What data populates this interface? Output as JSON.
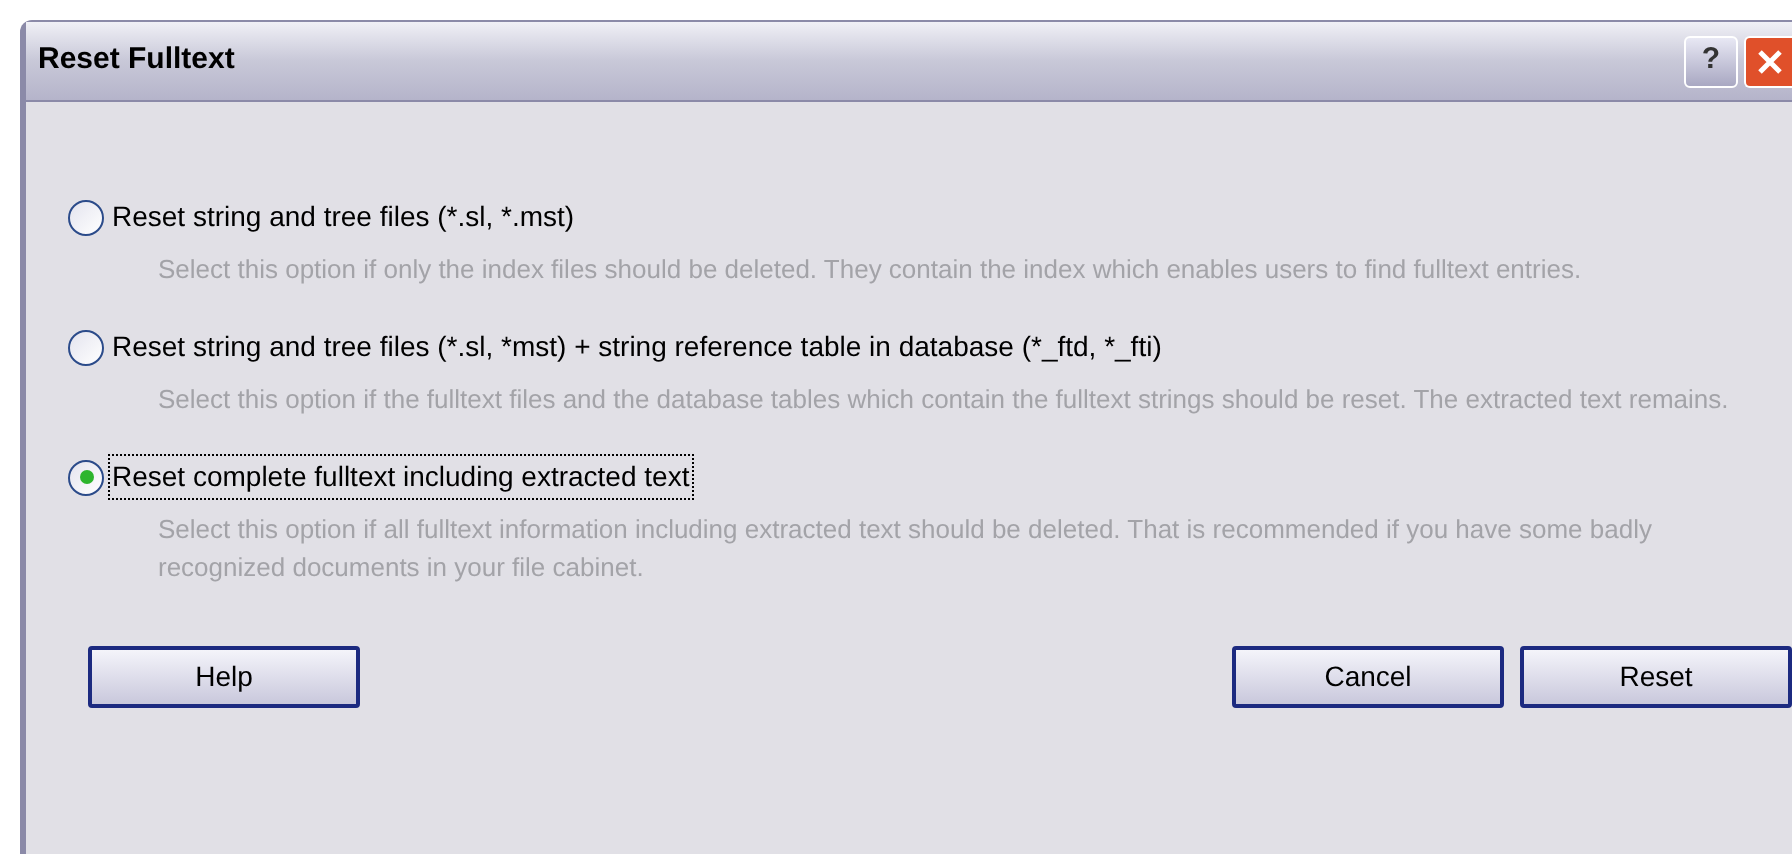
{
  "window": {
    "title": "Reset Fulltext",
    "help_glyph": "?"
  },
  "options": [
    {
      "label": "Reset string and tree files (*.sl, *.mst)",
      "description": "Select this option if only the index files should be deleted. They contain the index which enables users to find fulltext entries.",
      "selected": false
    },
    {
      "label": "Reset string and tree files (*.sl, *mst) + string reference table in database (*_ftd, *_fti)",
      "description": "Select this option if the fulltext files and the database tables which contain the fulltext strings should be reset. The extracted text remains.",
      "selected": false
    },
    {
      "label": "Reset complete fulltext including extracted text",
      "description": "Select this option if all fulltext information including extracted text should be deleted. That is recommended if you have some badly recognized documents in your file cabinet.",
      "selected": true
    }
  ],
  "buttons": {
    "help": "Help",
    "cancel": "Cancel",
    "reset": "Reset"
  }
}
